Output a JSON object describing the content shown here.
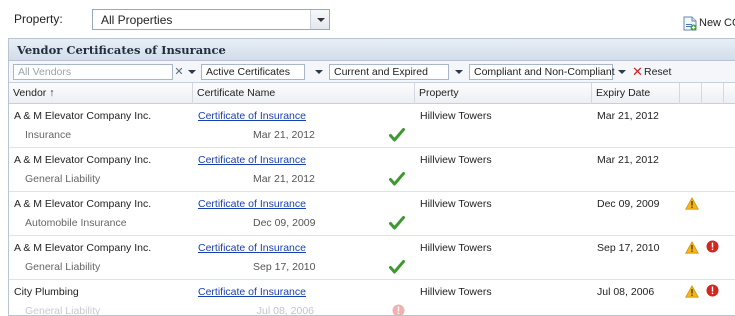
{
  "topbar": {
    "property_label": "Property:",
    "property_value": "All Properties",
    "new_button_label": "New CO"
  },
  "panel": {
    "title": "Vendor Certificates of Insurance"
  },
  "filters": {
    "vendor_placeholder": "All Vendors",
    "status": "Active Certificates",
    "period": "Current and Expired",
    "compliance": "Compliant and Non-Compliant",
    "reset_label": "Reset"
  },
  "columns": [
    "Vendor ↑",
    "Certificate Name",
    "Property",
    "Expiry Date"
  ],
  "rows": [
    {
      "vendor": "A & M Elevator Company Inc.",
      "type": "Insurance",
      "certificate": "Certificate of Insurance",
      "cert_date": "Mar 21, 2012",
      "property": "Hillview Towers",
      "expiry": "Mar 21, 2012",
      "check": true,
      "warning": false,
      "error": false
    },
    {
      "vendor": "A & M Elevator Company Inc.",
      "type": "General Liability",
      "certificate": "Certificate of Insurance",
      "cert_date": "Mar 21, 2012",
      "property": "Hillview Towers",
      "expiry": "Mar 21, 2012",
      "check": true,
      "warning": false,
      "error": false
    },
    {
      "vendor": "A & M Elevator Company Inc.",
      "type": "Automobile Insurance",
      "certificate": "Certificate of Insurance",
      "cert_date": "Dec 09, 2009",
      "property": "Hillview Towers",
      "expiry": "Dec 09, 2009",
      "check": true,
      "warning": true,
      "error": false
    },
    {
      "vendor": "A & M Elevator Company Inc.",
      "type": "General Liability",
      "certificate": "Certificate of Insurance",
      "cert_date": "Sep 17, 2010",
      "property": "Hillview Towers",
      "expiry": "Sep 17, 2010",
      "check": true,
      "warning": true,
      "error": true
    },
    {
      "vendor": "City Plumbing",
      "type": "General Liability",
      "certificate": "Certificate of Insurance",
      "cert_date": "Jul 08, 2006",
      "property": "Hillview Towers",
      "expiry": "Jul 08, 2006",
      "check": false,
      "warning": true,
      "error": true
    }
  ],
  "colors": {
    "link": "#1a3fae",
    "check": "#3e9a2e",
    "warning": "#f2b51c",
    "error": "#d0281f",
    "reset_x": "#d4201b"
  },
  "icons": {
    "new_button": "new-document-icon",
    "check": "check-icon",
    "warning": "warning-icon",
    "error": "error-icon"
  }
}
